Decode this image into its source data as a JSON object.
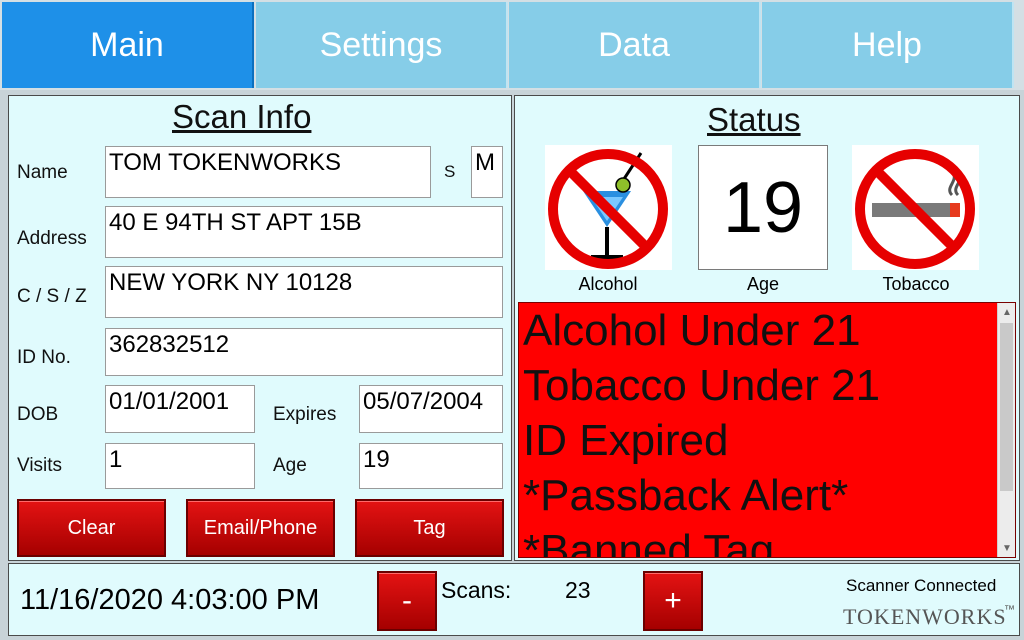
{
  "tabs": [
    {
      "label": "Main",
      "active": true
    },
    {
      "label": "Settings",
      "active": false
    },
    {
      "label": "Data",
      "active": false
    },
    {
      "label": "Help",
      "active": false
    }
  ],
  "scan_info": {
    "title": "Scan Info",
    "name_label": "Name",
    "name_value": "TOM  TOKENWORKS",
    "sex_label": "S",
    "sex_value": "M",
    "address_label": "Address",
    "address_value": "40 E 94TH ST APT 15B",
    "csz_label": "C / S / Z",
    "csz_value": "NEW YORK NY 10128",
    "id_label": "ID No.",
    "id_value": "362832512",
    "dob_label": "DOB",
    "dob_value": "01/01/2001",
    "expires_label": "Expires",
    "expires_value": "05/07/2004",
    "visits_label": "Visits",
    "visits_value": "1",
    "age_label": "Age",
    "age_value": "19",
    "buttons": {
      "clear": "Clear",
      "email_phone": "Email/Phone",
      "tag": "Tag"
    }
  },
  "status": {
    "title": "Status",
    "alcohol_label": "Alcohol",
    "age_label": "Age",
    "age_value": "19",
    "tobacco_label": "Tobacco",
    "alerts": [
      "Alcohol Under 21",
      "Tobacco Under 21",
      "ID Expired",
      "*Passback Alert*",
      "*Banned Tag"
    ]
  },
  "bottom": {
    "datetime": "11/16/2020 4:03:00 PM",
    "minus_label": "-",
    "scans_label": "Scans:",
    "scans_value": "23",
    "plus_label": "+",
    "scanner_status": "Scanner Connected",
    "logo_text": "TOKENWORKS",
    "logo_tm": "™"
  },
  "colors": {
    "active_tab": "#1e90e8",
    "inactive_tab": "#86cde8",
    "alert_bg": "#ff0000",
    "button_red": "#d00000",
    "panel_bg": "#e0fbfd"
  }
}
